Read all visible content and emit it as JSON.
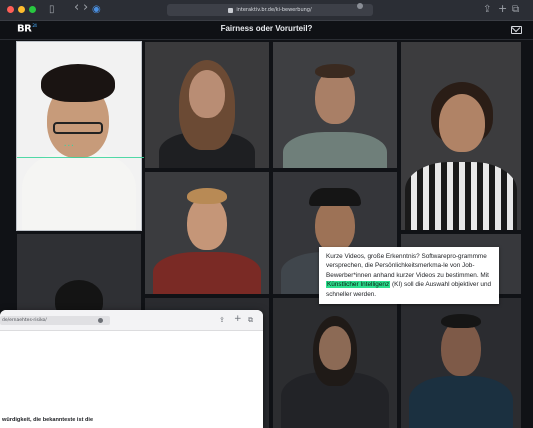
{
  "browser": {
    "url": "interaktiv.br.de/ki-bewerbung/",
    "icons": {
      "sidebar": "▯",
      "back": "‹",
      "forward": "›",
      "shield": "◉",
      "share": "⇪",
      "new_tab": "+",
      "tabs": "⧉"
    }
  },
  "app": {
    "logo": "BR",
    "logo_suffix": "24",
    "title": "Fairness oder Vorurteil?",
    "mail_icon": "mail-icon"
  },
  "caption": {
    "text_before": "Kurze Videos, große Erkenntnis? Softwarepro-grammme versprechen, die Persönlichkeitsmerkma-le von Job-Bewerber*innen anhand kurzer Videos zu bestimmen. Mit ",
    "highlight": "Künstlicher Intelligenz",
    "text_after": " (KI) soll die Auswahl objektiver und schneller werden."
  },
  "popup": {
    "url": "de/ernaehtes-risiko/",
    "icons": {
      "share": "⇪",
      "new_tab": "+",
      "tabs": "⧉"
    },
    "body_text": "würdigkeit, die bekannteste ist die"
  },
  "colors": {
    "accent_green": "#2ee08f",
    "scan_green": "#34d399",
    "background": "#101216"
  }
}
